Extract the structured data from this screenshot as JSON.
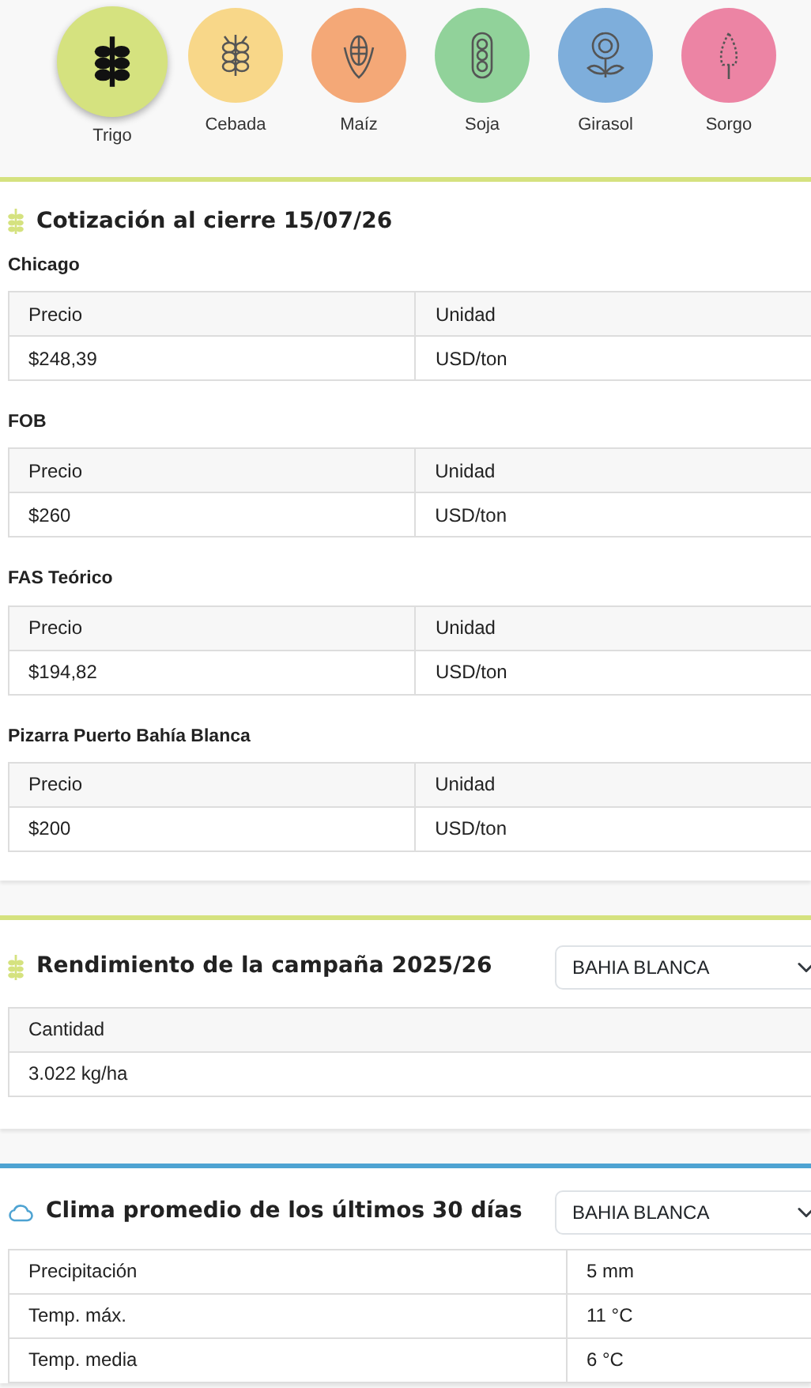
{
  "crops": [
    {
      "label": "Trigo",
      "selected": true,
      "color": "#d5e27f",
      "kind": "wheat"
    },
    {
      "label": "Cebada",
      "selected": false,
      "color": "#f8d789",
      "kind": "barley"
    },
    {
      "label": "Maíz",
      "selected": false,
      "color": "#f4a877",
      "kind": "corn"
    },
    {
      "label": "Soja",
      "selected": false,
      "color": "#91d29a",
      "kind": "soy"
    },
    {
      "label": "Girasol",
      "selected": false,
      "color": "#7eaedb",
      "kind": "sunflower"
    },
    {
      "label": "Sorgo",
      "selected": false,
      "color": "#ec84a4",
      "kind": "sorghum"
    }
  ],
  "quotes": {
    "title": "Cotización al cierre 15/07/26",
    "markets": [
      {
        "name": "Chicago",
        "columns": [
          "Precio",
          "Unidad"
        ],
        "rows": [
          [
            "$248,39",
            "USD/ton"
          ]
        ]
      },
      {
        "name": "FOB",
        "columns": [
          "Precio",
          "Unidad"
        ],
        "rows": [
          [
            "$260",
            "USD/ton"
          ]
        ]
      },
      {
        "name": "FAS Teórico",
        "columns": [
          "Precio",
          "Unidad"
        ],
        "rows": [
          [
            "$194,82",
            "USD/ton"
          ]
        ]
      },
      {
        "name": "Pizarra Puerto Bahía Blanca",
        "columns": [
          "Precio",
          "Unidad"
        ],
        "rows": [
          [
            "$200",
            "USD/ton"
          ]
        ]
      }
    ]
  },
  "yield": {
    "title": "Rendimiento de la campaña 2025/26",
    "location": "BAHIA BLANCA",
    "columns": [
      "Cantidad"
    ],
    "rows": [
      [
        "3.022 kg/ha"
      ]
    ]
  },
  "climate": {
    "title": "Clima promedio de los últimos 30 días",
    "location": "BAHIA BLANCA",
    "rows": [
      [
        "Precipitación",
        "5 mm"
      ],
      [
        "Temp. máx.",
        "11 °C"
      ],
      [
        "Temp. media",
        "6 °C"
      ]
    ]
  }
}
